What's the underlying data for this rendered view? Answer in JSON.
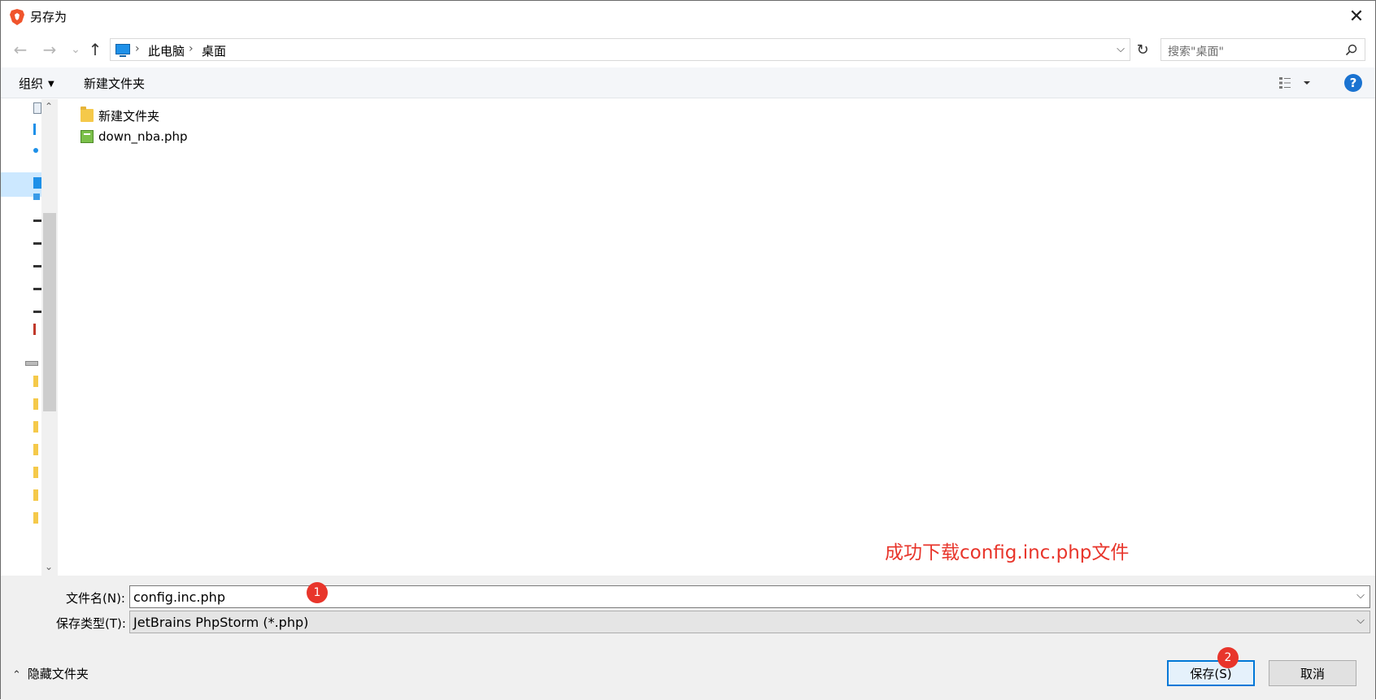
{
  "window": {
    "title": "另存为",
    "close_glyph": "✕"
  },
  "nav": {
    "back_glyph": "←",
    "forward_glyph": "→",
    "recent_glyph": "⌄",
    "up_glyph": "↑",
    "breadcrumb": [
      "此电脑",
      "桌面"
    ],
    "breadcrumb_separator": "›",
    "address_dropdown_glyph": "⌵",
    "refresh_glyph": "↻"
  },
  "search": {
    "placeholder": "搜索\"桌面\""
  },
  "toolbar": {
    "organize_label": "组织",
    "organize_caret": "▼",
    "new_folder_label": "新建文件夹",
    "help_label": "?"
  },
  "navpane": {
    "scroll_up_glyph": "⌃",
    "scroll_down_glyph": "⌄"
  },
  "files": [
    {
      "name": "新建文件夹",
      "icon": "folder-icon"
    },
    {
      "name": "down_nba.php",
      "icon": "php-file-icon"
    }
  ],
  "annotation": {
    "text": "成功下载config.inc.php文件",
    "color": "#e8352b",
    "badge_1": "1",
    "badge_2": "2"
  },
  "form": {
    "filename_label": "文件名(N):",
    "filename_value": "config.inc.php",
    "filetype_label": "保存类型(T):",
    "filetype_value": "JetBrains PhpStorm (*.php)",
    "dropdown_glyph": "⌵"
  },
  "footer": {
    "hide_folders_caret": "⌃",
    "hide_folders_label": "隐藏文件夹",
    "save_label": "保存(S)",
    "cancel_label": "取消"
  },
  "colors": {
    "accent": "#0078d7",
    "selection": "#cce8ff"
  }
}
